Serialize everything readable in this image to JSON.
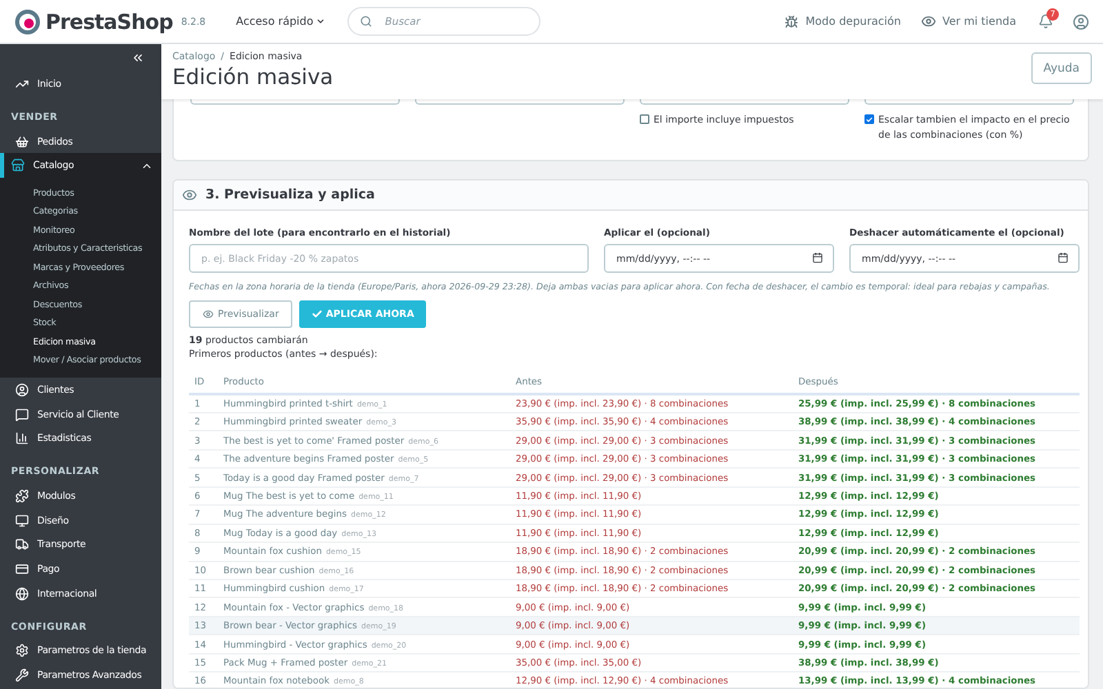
{
  "header": {
    "logo": "PrestaShop",
    "version": "8.2.8",
    "quick_access": "Acceso rápido",
    "search": {
      "placeholder": "Buscar"
    },
    "debug": "Modo depuración",
    "view_shop": "Ver mi tienda",
    "notifications": "7"
  },
  "sidebar": {
    "groups": [
      {
        "items": [
          {
            "label": "Inicio",
            "selected": false
          }
        ]
      },
      {
        "title": "VENDER",
        "items": [
          {
            "label": "Pedidos",
            "selected": false
          },
          {
            "label": "Catalogo",
            "selected": true,
            "expanded": true,
            "children": [
              {
                "label": "Productos",
                "selected": false
              },
              {
                "label": "Categorias",
                "selected": false
              },
              {
                "label": "Monitoreo",
                "selected": false
              },
              {
                "label": "Atributos y Caracteristicas",
                "selected": false
              },
              {
                "label": "Marcas y Proveedores",
                "selected": false
              },
              {
                "label": "Archivos",
                "selected": false
              },
              {
                "label": "Descuentos",
                "selected": false
              },
              {
                "label": "Stock",
                "selected": false
              },
              {
                "label": "Edicion masiva",
                "selected": true
              },
              {
                "label": "Mover / Asociar productos",
                "selected": false
              }
            ]
          },
          {
            "label": "Clientes",
            "selected": false
          },
          {
            "label": "Servicio al Cliente",
            "selected": false
          },
          {
            "label": "Estadisticas",
            "selected": false
          }
        ]
      },
      {
        "title": "PERSONALIZAR",
        "items": [
          {
            "label": "Modulos",
            "selected": false
          },
          {
            "label": "Diseño",
            "selected": false
          },
          {
            "label": "Transporte",
            "selected": false
          },
          {
            "label": "Pago",
            "selected": false
          },
          {
            "label": "Internacional",
            "selected": false
          }
        ]
      },
      {
        "title": "CONFIGURAR",
        "items": [
          {
            "label": "Parametros de la tienda",
            "selected": false
          },
          {
            "label": "Parametros Avanzados",
            "selected": false
          }
        ]
      }
    ]
  },
  "breadcrumb": [
    "Catalogo",
    "Edicion masiva"
  ],
  "breadcrumb_separator": "/",
  "page_title": "Edición masiva",
  "help_button": "Ayuda",
  "options": [
    {
      "label": "El importe incluye impuestos",
      "checked": false
    },
    {
      "label": "Escalar tambien el impacto en el precio de las combinaciones (con %)",
      "checked": true
    }
  ],
  "preview_card": {
    "title": "3. Previsualiza y aplica",
    "fields": [
      {
        "label": "Nombre del lote (para encontrarlo en el historial)",
        "placeholder": "p. ej. Black Friday -20 % zapatos",
        "kind": "text"
      },
      {
        "label": "Aplicar el (opcional)",
        "placeholder": "mm/dd/yyyy, --:-- --",
        "kind": "datetime"
      },
      {
        "label": "Deshacer automáticamente el (opcional)",
        "placeholder": "mm/dd/yyyy, --:-- --",
        "kind": "datetime"
      }
    ],
    "hint": "Fechas en la zona horaria de la tienda (Europe/Paris, ahora 2026-09-29 23:28). Deja ambas vacias para aplicar ahora. Con fecha de deshacer, el cambio es temporal: ideal para rebajas y campañas.",
    "preview_button": "Previsualizar",
    "apply_button": "APLICAR AHORA",
    "summary": "**19** productos cambiarán",
    "subtitle": "Primeros productos (antes → después):",
    "table": {
      "columns": [
        "ID",
        "Producto",
        "Antes",
        "Después"
      ],
      "rows": [
        {
          "id": "1",
          "name": "Hummingbird printed t-shirt",
          "ref": "demo_1",
          "before": "23,90 € (imp. incl. 23,90 €) · 8 combinaciones",
          "after": "25,99 € (imp. incl. 25,99 €) · 8 combinaciones",
          "highlighted": false
        },
        {
          "id": "2",
          "name": "Hummingbird printed sweater",
          "ref": "demo_3",
          "before": "35,90 € (imp. incl. 35,90 €) · 4 combinaciones",
          "after": "38,99 € (imp. incl. 38,99 €) · 4 combinaciones",
          "highlighted": false
        },
        {
          "id": "3",
          "name": "The best is yet to come' Framed poster",
          "ref": "demo_6",
          "before": "29,00 € (imp. incl. 29,00 €) · 3 combinaciones",
          "after": "31,99 € (imp. incl. 31,99 €) · 3 combinaciones",
          "highlighted": false
        },
        {
          "id": "4",
          "name": "The adventure begins Framed poster",
          "ref": "demo_5",
          "before": "29,00 € (imp. incl. 29,00 €) · 3 combinaciones",
          "after": "31,99 € (imp. incl. 31,99 €) · 3 combinaciones",
          "highlighted": false
        },
        {
          "id": "5",
          "name": "Today is a good day Framed poster",
          "ref": "demo_7",
          "before": "29,00 € (imp. incl. 29,00 €) · 3 combinaciones",
          "after": "31,99 € (imp. incl. 31,99 €) · 3 combinaciones",
          "highlighted": false
        },
        {
          "id": "6",
          "name": "Mug The best is yet to come",
          "ref": "demo_11",
          "before": "11,90 € (imp. incl. 11,90 €)",
          "after": "12,99 € (imp. incl. 12,99 €)",
          "highlighted": false
        },
        {
          "id": "7",
          "name": "Mug The adventure begins",
          "ref": "demo_12",
          "before": "11,90 € (imp. incl. 11,90 €)",
          "after": "12,99 € (imp. incl. 12,99 €)",
          "highlighted": false
        },
        {
          "id": "8",
          "name": "Mug Today is a good day",
          "ref": "demo_13",
          "before": "11,90 € (imp. incl. 11,90 €)",
          "after": "12,99 € (imp. incl. 12,99 €)",
          "highlighted": false
        },
        {
          "id": "9",
          "name": "Mountain fox cushion",
          "ref": "demo_15",
          "before": "18,90 € (imp. incl. 18,90 €) · 2 combinaciones",
          "after": "20,99 € (imp. incl. 20,99 €) · 2 combinaciones",
          "highlighted": false
        },
        {
          "id": "10",
          "name": "Brown bear cushion",
          "ref": "demo_16",
          "before": "18,90 € (imp. incl. 18,90 €) · 2 combinaciones",
          "after": "20,99 € (imp. incl. 20,99 €) · 2 combinaciones",
          "highlighted": false
        },
        {
          "id": "11",
          "name": "Hummingbird cushion",
          "ref": "demo_17",
          "before": "18,90 € (imp. incl. 18,90 €) · 2 combinaciones",
          "after": "20,99 € (imp. incl. 20,99 €) · 2 combinaciones",
          "highlighted": false
        },
        {
          "id": "12",
          "name": "Mountain fox - Vector graphics",
          "ref": "demo_18",
          "before": "9,00 € (imp. incl. 9,00 €)",
          "after": "9,99 € (imp. incl. 9,99 €)",
          "highlighted": false
        },
        {
          "id": "13",
          "name": "Brown bear - Vector graphics",
          "ref": "demo_19",
          "before": "9,00 € (imp. incl. 9,00 €)",
          "after": "9,99 € (imp. incl. 9,99 €)",
          "highlighted": true
        },
        {
          "id": "14",
          "name": "Hummingbird - Vector graphics",
          "ref": "demo_20",
          "before": "9,00 € (imp. incl. 9,00 €)",
          "after": "9,99 € (imp. incl. 9,99 €)",
          "highlighted": false
        },
        {
          "id": "15",
          "name": "Pack Mug + Framed poster",
          "ref": "demo_21",
          "before": "35,00 € (imp. incl. 35,00 €)",
          "after": "38,99 € (imp. incl. 38,99 €)",
          "highlighted": false
        },
        {
          "id": "16",
          "name": "Mountain fox notebook",
          "ref": "demo_8",
          "before": "12,90 € (imp. incl. 12,90 €) · 4 combinaciones",
          "after": "13,99 € (imp. incl. 13,99 €) · 4 combinaciones",
          "highlighted": false
        }
      ]
    }
  }
}
